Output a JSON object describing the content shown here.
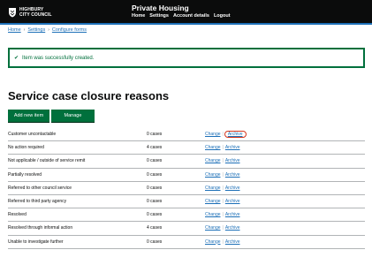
{
  "header": {
    "logo_line1": "HIGHBURY",
    "logo_line2": "CITY COUNCIL",
    "service_name": "Private Housing",
    "nav": [
      "Home",
      "Settings",
      "Account details",
      "Logout"
    ]
  },
  "breadcrumb": [
    "Home",
    "Settings",
    "Configure forms"
  ],
  "notice": {
    "text": "Item was successfully created."
  },
  "page_title": "Service case closure reasons",
  "buttons": {
    "add": "Add new item",
    "manage": "Manage archive"
  },
  "actions": {
    "change": "Change",
    "archive": "Archive"
  },
  "rows": [
    {
      "name": "Customer uncontactable",
      "count": "0 cases"
    },
    {
      "name": "No action required",
      "count": "4 cases"
    },
    {
      "name": "Not applicable / outside of service remit",
      "count": "0 cases"
    },
    {
      "name": "Partially resolved",
      "count": "0 cases"
    },
    {
      "name": "Referred to other council service",
      "count": "0 cases"
    },
    {
      "name": "Referred to third party agency",
      "count": "0 cases"
    },
    {
      "name": "Resolved",
      "count": "0 cases"
    },
    {
      "name": "Resolved through informal action",
      "count": "4 cases"
    },
    {
      "name": "Unable to investigate further",
      "count": "0 cases"
    }
  ],
  "colors": {
    "header_bg": "#0b0c0c",
    "accent_blue": "#1d70b8",
    "success_green": "#00703c",
    "focus_red": "#d4351c"
  }
}
